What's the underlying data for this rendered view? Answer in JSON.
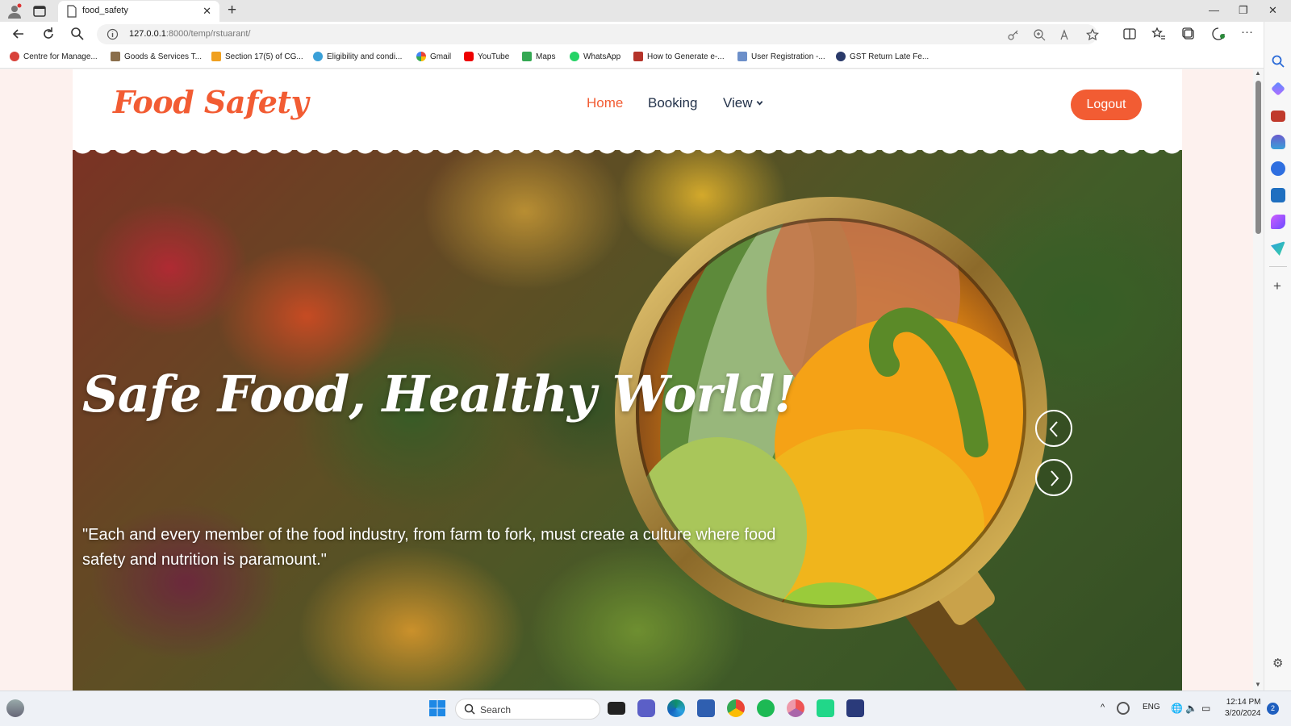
{
  "browser": {
    "tab_title": "food_safety",
    "url_host": "127.0.0.1",
    "url_path": ":8000/temp/rstuarant/",
    "bookmarks": [
      "Centre for Manage...",
      "Goods & Services T...",
      "Section 17(5) of CG...",
      "Eligibility and condi...",
      "Gmail",
      "YouTube",
      "Maps",
      "WhatsApp",
      "How to Generate e-...",
      "User Registration -...",
      "GST Return Late Fe..."
    ]
  },
  "site": {
    "brand": "Food Safety",
    "nav": {
      "home": "Home",
      "booking": "Booking",
      "view": "View"
    },
    "logout_label": "Logout",
    "hero": {
      "title": "Safe Food, Healthy World!",
      "quote": "\"Each and every member of the food industry, from farm to fork, must create a culture where food safety and nutrition is paramount.\""
    },
    "colors": {
      "accent": "#f25c33",
      "nav_text": "#23324a"
    }
  },
  "taskbar": {
    "search_label": "Search",
    "language": "ENG",
    "time": "12:14 PM",
    "date": "3/20/2024",
    "notification_count": "2"
  }
}
